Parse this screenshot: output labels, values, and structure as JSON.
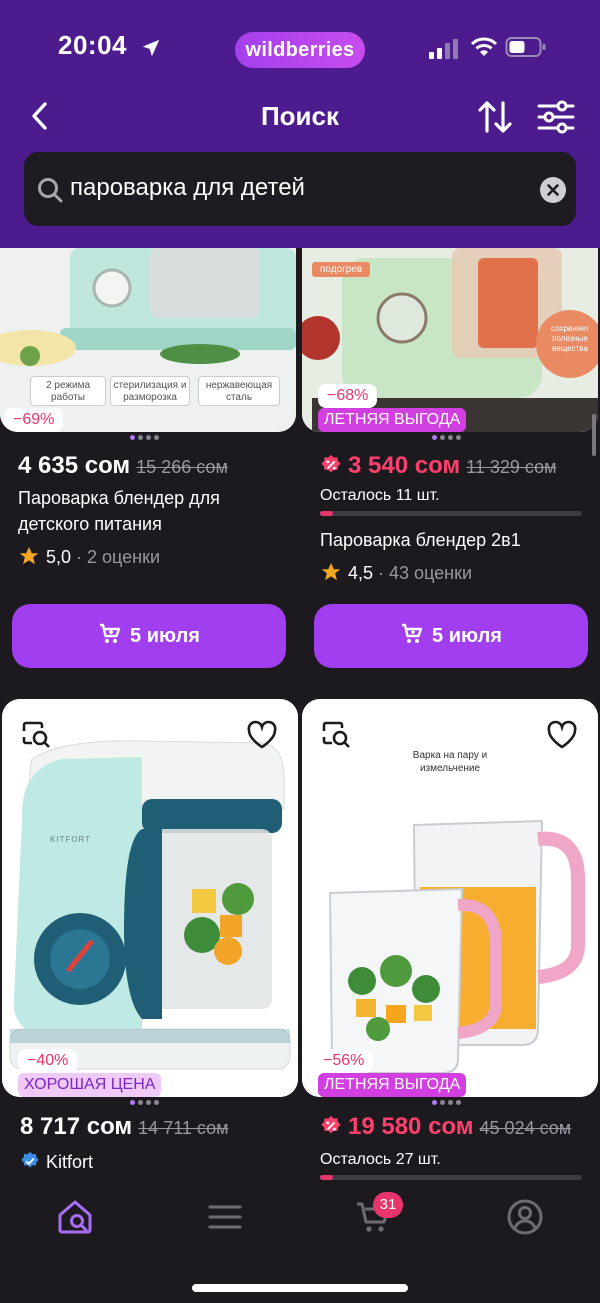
{
  "status_bar": {
    "time": "20:04",
    "brand_logo": "wildberries"
  },
  "header": {
    "title": "Поиск",
    "icons": [
      "back-icon",
      "sort-icon",
      "filter-icon"
    ]
  },
  "search": {
    "value": "пароварка для детей",
    "placeholder": ""
  },
  "products": [
    {
      "image_labels": [
        "2 режима работы",
        "стерилизация и разморозка",
        "нержавеющая сталь"
      ],
      "discount": "−69%",
      "price": "4 635 сом",
      "old_price": "15 266 сом",
      "name": "Пароварка блендер для детского питания",
      "rating": "5,0",
      "reviews": "2 оценки",
      "delivery": "5 июля"
    },
    {
      "image_labels": [
        "подогрев",
        "сохраняет полезные вещества"
      ],
      "discount": "−68%",
      "promo": "ЛЕТНЯЯ ВЫГОДА",
      "price": "3 540 сом",
      "old_price": "11 329 сом",
      "stock": "Осталось 11 шт.",
      "stock_level": 0.05,
      "name": "Пароварка блендер 2в1",
      "rating": "4,5",
      "reviews": "43 оценки",
      "delivery": "5 июля"
    },
    {
      "image_labels": [
        "KITFORT"
      ],
      "discount": "−40%",
      "promo": "ХОРОШАЯ ЦЕНА",
      "price": "8 717 сом",
      "old_price": "14 711 сом",
      "brand": "Kitfort"
    },
    {
      "image_labels": [
        "Варка на пару и измельчение"
      ],
      "discount": "−56%",
      "promo": "ЛЕТНЯЯ ВЫГОДА",
      "price": "19 580 сом",
      "old_price": "45 024 сом",
      "stock": "Осталось 27 шт.",
      "stock_level": 0.05
    }
  ],
  "tabbar": {
    "items": [
      "home-search-icon",
      "catalog-icon",
      "cart-icon",
      "profile-icon"
    ],
    "cart_count": "31"
  },
  "colors": {
    "header_bg": "#4c1b8e",
    "accent": "#a13ef0",
    "sale": "#ff3f6c",
    "page_bg": "#1c1a1f"
  }
}
